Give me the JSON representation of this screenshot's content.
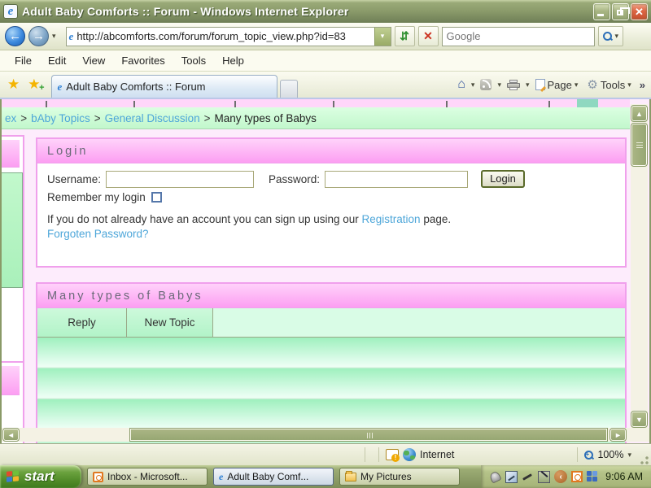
{
  "icons": {
    "ie": "e",
    "close": "✕",
    "dropdown": "▾",
    "overflow": "»",
    "back": "←",
    "forward": "→",
    "refresh": "⇵",
    "stop": "✕",
    "star": "★",
    "star_plus": "+",
    "home": "⌂",
    "gear": "⚙",
    "scroll_up": "▲",
    "scroll_down": "▼",
    "scroll_left": "◄",
    "scroll_right": "►",
    "tray_chevron": "‹"
  },
  "window": {
    "title": "Adult Baby Comforts :: Forum - Windows Internet Explorer"
  },
  "address_bar": {
    "url": "http://abcomforts.com/forum/forum_topic_view.php?id=83",
    "search_placeholder": "Google"
  },
  "menu_bar": {
    "items": [
      "File",
      "Edit",
      "View",
      "Favorites",
      "Tools",
      "Help"
    ]
  },
  "tab_bar": {
    "active_tab": "Adult Baby Comforts :: Forum",
    "page_label": "Page",
    "tools_label": "Tools"
  },
  "page": {
    "breadcrumb": {
      "separator": ">",
      "items": [
        {
          "label": "ex"
        },
        {
          "label": "bAby Topics"
        },
        {
          "label": "General Discussion"
        },
        {
          "label": "Many types of Babys"
        }
      ]
    },
    "login": {
      "title": "Login",
      "username_label": "Username:",
      "password_label": "Password:",
      "login_button": "Login",
      "remember_label": "Remember my login",
      "signup_text_before": "If you do not already have an account you can sign up using our",
      "signup_link": "Registration",
      "signup_text_after": "page.",
      "forgot_link": "Forgoten Password?"
    },
    "topic": {
      "title": "Many types of Babys",
      "reply_button": "Reply",
      "new_topic_button": "New Topic"
    }
  },
  "status_bar": {
    "zone": "Internet",
    "zoom": "100%"
  },
  "taskbar": {
    "start_label": "start",
    "tasks": [
      {
        "label": "Inbox - Microsoft..."
      },
      {
        "label": "Adult Baby Comf..."
      },
      {
        "label": "My Pictures"
      }
    ],
    "clock": "9:06 AM"
  }
}
